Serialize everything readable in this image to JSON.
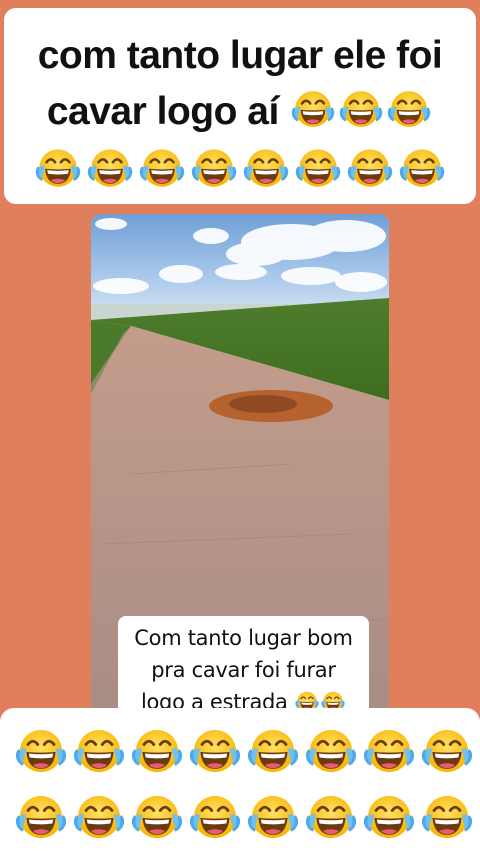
{
  "header": {
    "line1": "com tanto lugar ele foi",
    "line2_text": "cavar logo aí",
    "line2_emoji_count": 3,
    "line3_emoji_count": 8
  },
  "video_caption": {
    "line1": "Com tanto lugar bom",
    "line2": "pra cavar foi furar",
    "line3_text": "logo a estrada",
    "line3_emoji_count": 2
  },
  "footer": {
    "row1_emoji_count": 8,
    "row2_emoji_count": 8
  },
  "emoji": {
    "name": "face-with-tears-of-joy-icon"
  },
  "colors": {
    "background": "#E07F5C",
    "card": "#FFFFFF",
    "emoji_face": "#FFC83D",
    "emoji_tear": "#4FA8E8"
  }
}
